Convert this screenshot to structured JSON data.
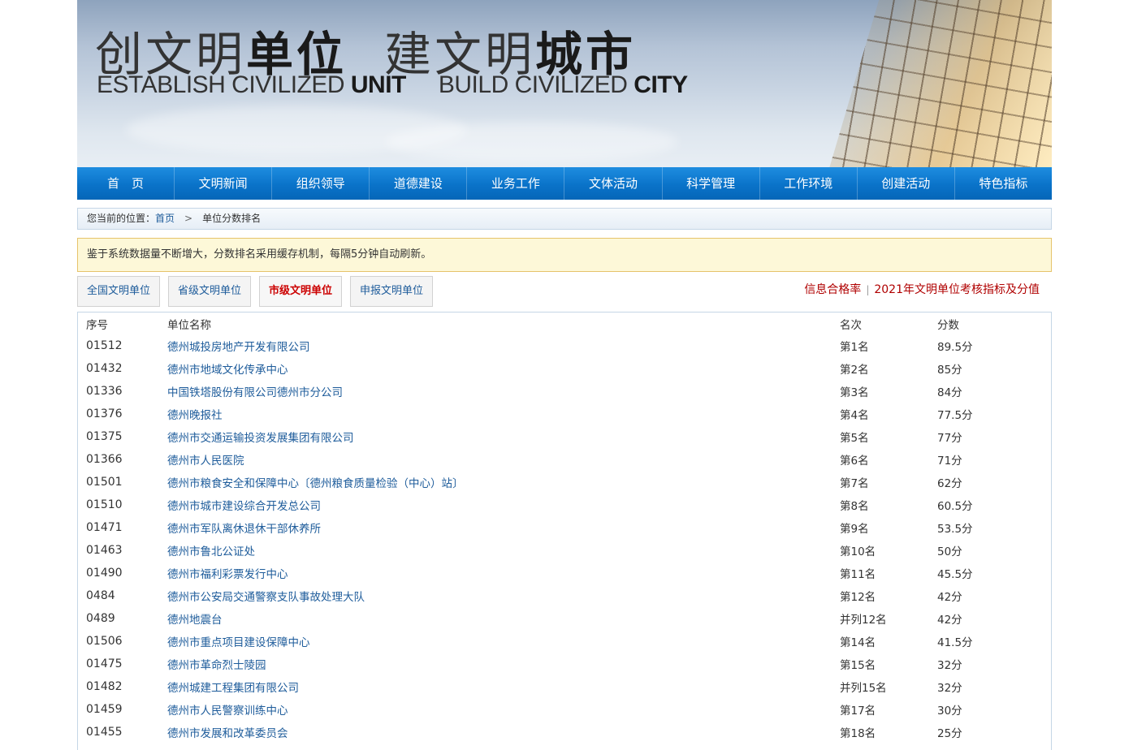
{
  "banner": {
    "slogan_cn_1": "创文明",
    "slogan_cn_1b": "单位",
    "slogan_cn_2": "建文明",
    "slogan_cn_2b": "城市",
    "slogan_en_1": "ESTABLISH CIVILIZED ",
    "slogan_en_1b": "UNIT",
    "slogan_en_2": "BUILD CIVILIZED ",
    "slogan_en_2b": "CITY"
  },
  "nav": {
    "items": [
      "首　页",
      "文明新闻",
      "组织领导",
      "道德建设",
      "业务工作",
      "文体活动",
      "科学管理",
      "工作环境",
      "创建活动",
      "特色指标"
    ]
  },
  "breadcrumb": {
    "prefix": "您当前的位置：",
    "home": "首页",
    "separator": ">",
    "current": "单位分数排名"
  },
  "notice": {
    "text": "鉴于系统数据量不断增大，分数排名采用缓存机制，每隔5分钟自动刷新。"
  },
  "tabs": {
    "items": [
      "全国文明单位",
      "省级文明单位",
      "市级文明单位",
      "申报文明单位"
    ],
    "active": "市级文明单位"
  },
  "right_links": {
    "link1": "信息合格率",
    "divider": "|",
    "link2": "2021年文明单位考核指标及分值"
  },
  "table": {
    "headers": [
      "序号",
      "单位名称",
      "名次",
      "分数"
    ],
    "rows": [
      [
        "01512",
        "德州城投房地产开发有限公司",
        "第1名",
        "89.5分"
      ],
      [
        "01432",
        "德州市地域文化传承中心",
        "第2名",
        "85分"
      ],
      [
        "01336",
        "中国铁塔股份有限公司德州市分公司",
        "第3名",
        "84分"
      ],
      [
        "01376",
        "德州晚报社",
        "第4名",
        "77.5分"
      ],
      [
        "01375",
        "德州市交通运输投资发展集团有限公司",
        "第5名",
        "77分"
      ],
      [
        "01366",
        "德州市人民医院",
        "第6名",
        "71分"
      ],
      [
        "01501",
        "德州市粮食安全和保障中心〔德州粮食质量检验（中心）站〕",
        "第7名",
        "62分"
      ],
      [
        "01510",
        "德州市城市建设综合开发总公司",
        "第8名",
        "60.5分"
      ],
      [
        "01471",
        "德州市军队离休退休干部休养所",
        "第9名",
        "53.5分"
      ],
      [
        "01463",
        "德州市鲁北公证处",
        "第10名",
        "50分"
      ],
      [
        "01490",
        "德州市福利彩票发行中心",
        "第11名",
        "45.5分"
      ],
      [
        "0484",
        "德州市公安局交通警察支队事故处理大队",
        "第12名",
        "42分"
      ],
      [
        "0489",
        "德州地震台",
        "并列12名",
        "42分"
      ],
      [
        "01506",
        "德州市重点项目建设保障中心",
        "第14名",
        "41.5分"
      ],
      [
        "01475",
        "德州市革命烈士陵园",
        "第15名",
        "32分"
      ],
      [
        "01482",
        "德州城建工程集团有限公司",
        "并列15名",
        "32分"
      ],
      [
        "01459",
        "德州市人民警察训练中心",
        "第17名",
        "30分"
      ],
      [
        "01455",
        "德州市发展和改革委员会",
        "第18名",
        "25分"
      ]
    ]
  },
  "colors": {
    "nav_blue": "#0a73c9",
    "link_blue": "#1e5c9b",
    "active_red": "#cc0000",
    "notice_bg": "#fdf8d8"
  }
}
